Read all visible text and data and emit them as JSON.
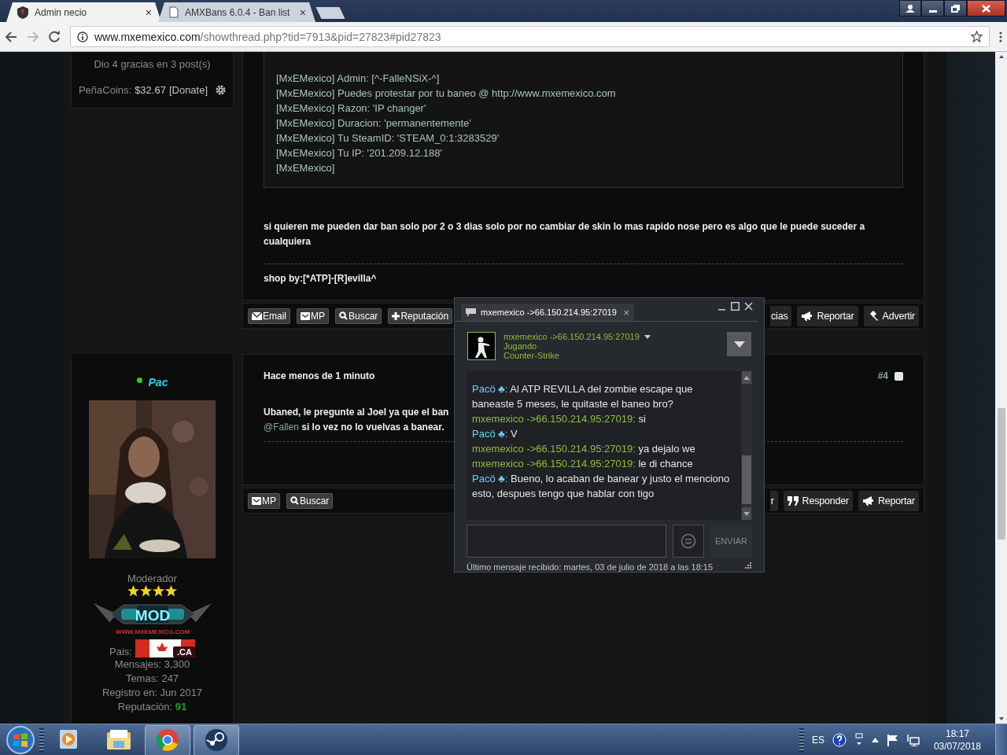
{
  "browser": {
    "tabs": [
      {
        "title": "Admin necio",
        "close": "×",
        "selected": true
      },
      {
        "title": "AMXBans 6.0.4 - Ban list",
        "close": "×",
        "selected": false
      }
    ],
    "url": {
      "host": "www.mxemexico.com",
      "path": "/showthread.php?tid=7913&pid=27823#pid27823"
    }
  },
  "post1": {
    "author": {
      "thanks": "Dio 4 gracias en 3 post(s)",
      "coins_label": "PeñaCoins:",
      "coins": "$32.67",
      "donate": "[Donate]"
    },
    "quote": [
      "[MxEMexico] Admin: [^-FalleNSiX-^]",
      "[MxEMexico] Puedes protestar por tu baneo @ http://www.mxemexico.com",
      "[MxEMexico] Razon: 'IP changer'",
      "[MxEMexico] Duracion: 'permanentemente'",
      "[MxEMexico] Tu SteamID: 'STEAM_0:1:3283529'",
      "[MxEMexico] Tu IP: '201.209.12.188'",
      "[MxEMexico]"
    ],
    "message": "si quieren me pueden dar ban solo por 2 o 3 dias solo por no cambiar de skin lo mas rapido nose pero es algo que le puede suceder a cualquiera",
    "signature": "shop by:[*ATP]-[R]evilla^",
    "left_buttons": [
      {
        "label": "Email",
        "kind": "mail"
      },
      {
        "label": "MP",
        "kind": "pm"
      },
      {
        "label": "Buscar",
        "kind": "search"
      },
      {
        "label": "Reputación",
        "kind": "plus"
      }
    ],
    "right_buttons": [
      {
        "label": "cias",
        "kind": "partial"
      },
      {
        "label": "Reportar",
        "kind": "megaphone"
      },
      {
        "label": "Advertir",
        "kind": "hammer"
      }
    ]
  },
  "post2": {
    "author": {
      "name": "Pac",
      "online": true,
      "role": "Moderador",
      "stars": 4,
      "badge": "MOD",
      "badge_site": "WWW.MXEMEXICO.COM",
      "country_label": "Pais:",
      "flag_code": ".CA",
      "stats": [
        "Mensajes: 3,300",
        "Temas: 247",
        "Registro en: Jun 2017",
        "Reputación: **91**"
      ]
    },
    "time": "Hace menos de 1 minuto",
    "number": "#4",
    "checked": false,
    "line1": "Ubaned, le pregunte al Joel ya que el ban",
    "mention": "@Fallen",
    "line2": "si lo vez no lo vuelvas a banear.",
    "left_buttons": [
      {
        "label": "MP",
        "kind": "pm"
      },
      {
        "label": "Buscar",
        "kind": "search"
      }
    ],
    "right_buttons": [
      {
        "label": "r",
        "kind": "partial"
      },
      {
        "label": "Responder",
        "kind": "quote"
      },
      {
        "label": "Reportar",
        "kind": "megaphone"
      }
    ]
  },
  "chat": {
    "title": "mxemexico ->66.150.214.95:27019",
    "close": "×",
    "friend": {
      "name": "mxemexico ->66.150.214.95:27019",
      "status": "Jugando",
      "game": "Counter-Strike"
    },
    "messages": [
      {
        "kind": "them",
        "sender": "Pacö ♣:",
        "text": "Al ATP REVILLA del zombie escape que baneaste 5 meses, le quitaste el baneo bro?"
      },
      {
        "kind": "me",
        "sender": "mxemexico ->66.150.214.95:27019:",
        "text": "si"
      },
      {
        "kind": "them",
        "sender": "Pacö ♣:",
        "text": "V"
      },
      {
        "kind": "me",
        "sender": "mxemexico ->66.150.214.95:27019:",
        "text": "ya dejalo we"
      },
      {
        "kind": "me",
        "sender": "mxemexico ->66.150.214.95:27019:",
        "text": "le di chance"
      },
      {
        "kind": "them",
        "sender": "Pacö ♣:",
        "text": "Bueno, lo acaban de banear y justo el menciono esto, despues tengo que hablar con tigo"
      }
    ],
    "send": "ENVIAR",
    "footer": "Último mensaje recibido: martes, 03 de julio de 2018 a las 18:15"
  },
  "taskbar": {
    "apps": [
      {
        "kind": "media",
        "open": false
      },
      {
        "kind": "explorer",
        "open": false
      },
      {
        "kind": "chrome",
        "open": true
      },
      {
        "kind": "steam",
        "open": true
      }
    ],
    "lang": "ES",
    "time": "18:17",
    "date": "03/07/2018"
  }
}
